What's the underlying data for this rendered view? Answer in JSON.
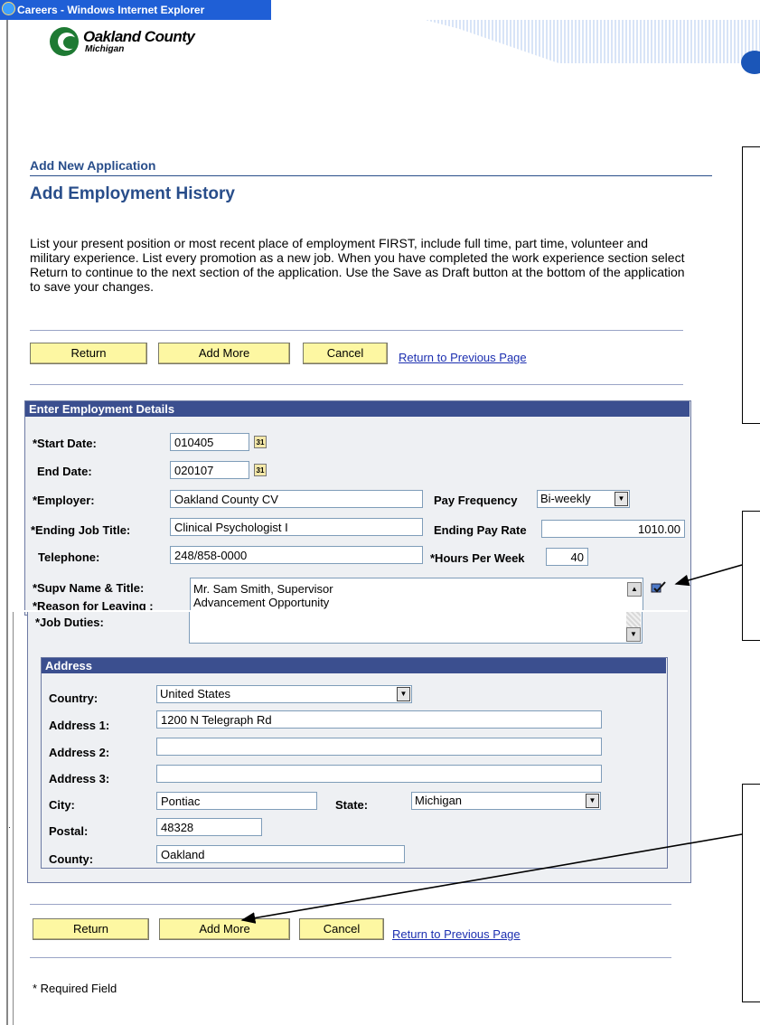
{
  "window": {
    "title": "Careers - Windows Internet Explorer"
  },
  "logo": {
    "name": "Oakland County",
    "sub": "Michigan"
  },
  "page": {
    "breadcrumb": "Add New Application",
    "title": "Add Employment History",
    "intro": "List your present position or most recent place of employment FIRST, include full time, part time, volunteer and military experience. List every promotion as a new job. When you have completed the work experience section select Return to continue to the next section of the application. Use the Save as Draft button at the bottom of the application to save your changes."
  },
  "buttons": {
    "return": "Return",
    "add_more": "Add More",
    "cancel": "Cancel",
    "return_prev": "Return to Previous Page"
  },
  "employment": {
    "header": "Enter Employment Details",
    "start_date_label": "*Start Date:",
    "start_date": "010405",
    "end_date_label": "End Date:",
    "end_date": "020107",
    "employer_label": "*Employer:",
    "employer": "Oakland County CV",
    "pay_frequency_label": "Pay Frequency",
    "pay_frequency": "Bi-weekly",
    "job_title_label": "*Ending Job Title:",
    "job_title": "Clinical Psychologist I",
    "pay_rate_label": "Ending Pay Rate",
    "pay_rate": "1010.00",
    "telephone_label": "Telephone:",
    "telephone": "248/858-0000",
    "hours_label": "*Hours Per Week",
    "hours": "40",
    "supv_label": "*Supv Name & Title:",
    "supv": "Mr. Sam Smith, Supervisor",
    "reason_label": "*Reason for Leaving :",
    "reason": "Advancement Opportunity",
    "duties_label": "*Job Duties:"
  },
  "address": {
    "header": "Address",
    "country_label": "Country:",
    "country": "United States",
    "address1_label": "Address 1:",
    "address1": "1200 N Telegraph Rd",
    "address2_label": "Address 2:",
    "address2": "",
    "address3_label": "Address 3:",
    "address3": "",
    "city_label": "City:",
    "city": "Pontiac",
    "state_label": "State:",
    "state": "Michigan",
    "postal_label": "Postal:",
    "postal": "48328",
    "county_label": "County:",
    "county": "Oakland"
  },
  "footer": {
    "required": "* Required Field"
  }
}
